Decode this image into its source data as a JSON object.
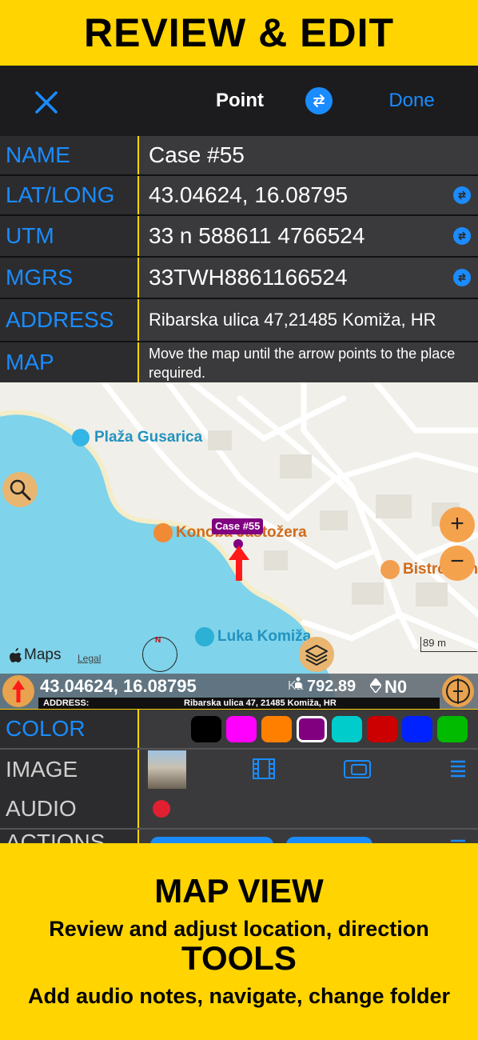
{
  "banner": {
    "top_title": "REVIEW & EDIT"
  },
  "navbar": {
    "title": "Point",
    "done_label": "Done"
  },
  "fields": {
    "name_label": "NAME",
    "name_value": "Case #55",
    "latlong_label": "LAT/LONG",
    "latlong_value": "43.04624, 16.08795",
    "utm_label": "UTM",
    "utm_value": "33 n 588611 4766524",
    "mgrs_label": "MGRS",
    "mgrs_value": "33TWH8861166524",
    "address_label": "ADDRESS",
    "address_value": "Ribarska ulica 47,21485 Komiža, HR",
    "map_label": "MAP",
    "map_hint": "Move the map until the arrow points to the place required."
  },
  "map": {
    "place_beach": "Plaža Gusarica",
    "place_restaurant": "Konoba Jastožera",
    "place_bistro": "Bistro Lan",
    "place_harbor": "Luka Komiža",
    "pin_label": "Case #55",
    "maps_brand": "Maps",
    "legal": "Legal",
    "scale": "89 m",
    "zoom_in": "+",
    "zoom_out": "−",
    "compass_mark": "N"
  },
  "statusbar": {
    "coords": "43.04624, 16.08795",
    "altitude": "792.89",
    "heading": "N0",
    "address_label": "ADDRESS:",
    "address_value": "Ribarska ulica 47, 21485 Komiža, HR",
    "map_overlay_fragment": "Ka",
    "map_overlay_small": "km"
  },
  "color_row": {
    "label": "COLOR",
    "swatches": [
      "#000000",
      "#FF00FF",
      "#FF8000",
      "#800080",
      "#00CCCC",
      "#CC0000",
      "#0022FF",
      "#00BB00"
    ],
    "selected_index": 3
  },
  "image_row": {
    "label": "IMAGE"
  },
  "audio_row": {
    "label": "AUDIO"
  },
  "actions_row": {
    "label": "ACTIONS"
  },
  "bottom": {
    "title1": "MAP VIEW",
    "sub1": "Review and adjust location, direction",
    "title2": "TOOLS",
    "sub2": "Add audio notes, navigate, change folder"
  },
  "colors": {
    "accent": "#1a8cff",
    "banner": "#FFD400",
    "water": "#7fd3ea",
    "pin": "#800080"
  }
}
